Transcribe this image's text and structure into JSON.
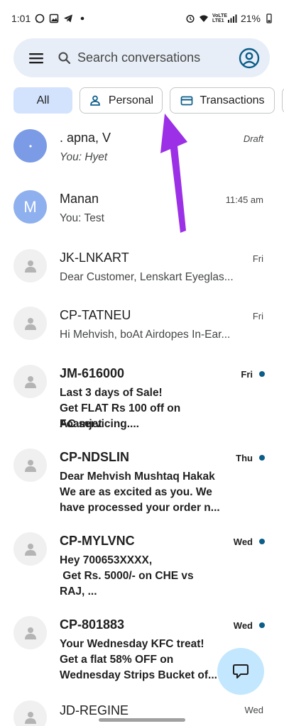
{
  "status": {
    "time": "1:01",
    "network_label_top": "VoLTE",
    "network_label_bottom": "LTE1",
    "battery": "21%"
  },
  "search": {
    "placeholder": "Search conversations",
    "icons": {
      "menu": "menu-icon",
      "search": "search-icon",
      "account": "account-circle-icon"
    }
  },
  "filters": [
    {
      "label": "All",
      "active": true
    },
    {
      "label": "Personal",
      "icon": "person-icon"
    },
    {
      "label": "Transactions",
      "icon": "card-icon"
    }
  ],
  "conversations": [
    {
      "title": ". apna, V",
      "snippet": [
        "You: Hyet"
      ],
      "time": "Draft",
      "unread": false,
      "avatar": "dot"
    },
    {
      "title": "Manan",
      "snippet": [
        "You: Test"
      ],
      "time": "11:45 am",
      "unread": false,
      "avatar": "M"
    },
    {
      "title": "JK-LNKART",
      "snippet": [
        "Dear Customer, Lenskart Eyeglas..."
      ],
      "time": "Fri",
      "unread": false,
      "avatar": "person"
    },
    {
      "title": "CP-TATNEU",
      "snippet": [
        "Hi Mehvish, boAt Airdopes In-Ear..."
      ],
      "time": "Fri",
      "unread": false,
      "avatar": "person"
    },
    {
      "title": "JM-616000",
      "snippet": [
        "Last 3 days of Sale!",
        "Get FLAT Rs 100 off on Foamjet",
        "AC servicing...."
      ],
      "time": "Fri",
      "unread": true,
      "avatar": "person"
    },
    {
      "title": "CP-NDSLIN",
      "snippet": [
        "Dear Mehvish Mushtaq Hakak",
        "We are as excited as you. We",
        "have processed your order n..."
      ],
      "time": "Thu",
      "unread": true,
      "avatar": "person"
    },
    {
      "title": "CP-MYLVNC",
      "snippet": [
        "Hey 700653XXXX,",
        " Get Rs. 5000/- on CHE vs",
        "RAJ, ..."
      ],
      "time": "Wed",
      "unread": true,
      "avatar": "person"
    },
    {
      "title": "CP-801883",
      "snippet": [
        "Your Wednesday KFC treat!",
        "Get a flat 58% OFF on",
        "Wednesday Strips Bucket of..."
      ],
      "time": "Wed",
      "unread": true,
      "avatar": "person"
    },
    {
      "title": "JD-REGINE",
      "snippet": [],
      "time": "Wed",
      "unread": false,
      "avatar": "person"
    }
  ],
  "fab": {
    "icon": "start-chat-icon"
  },
  "colors": {
    "accent": "#d3e3fd",
    "searchbar": "#e8eef7",
    "fab": "#c3e7fe",
    "unread_dot": "#0b5d8a",
    "arrow": "#9b30e6"
  }
}
